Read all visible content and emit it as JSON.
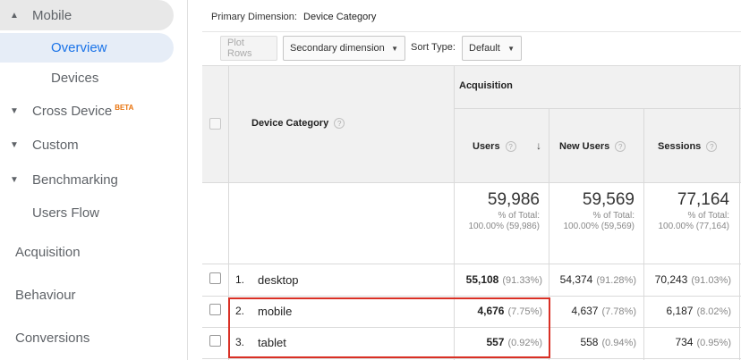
{
  "sidebar": {
    "mobile": "Mobile",
    "overview": "Overview",
    "devices": "Devices",
    "cross_device": "Cross Device",
    "cross_device_badge": "BETA",
    "custom": "Custom",
    "benchmarking": "Benchmarking",
    "users_flow": "Users Flow",
    "acquisition": "Acquisition",
    "behaviour": "Behaviour",
    "conversions": "Conversions"
  },
  "header": {
    "primary_dimension_label": "Primary Dimension:",
    "primary_dimension_value": "Device Category"
  },
  "toolbar": {
    "plot_rows": "Plot Rows",
    "secondary_dimension": "Secondary dimension",
    "sort_type_label": "Sort Type:",
    "sort_type_value": "Default"
  },
  "table": {
    "dimension_header": "Device Category",
    "group_header": "Acquisition",
    "columns": [
      "Users",
      "New Users",
      "Sessions"
    ],
    "totals": [
      {
        "value": "59,986",
        "label": "% of Total:",
        "detail": "100.00% (59,986)"
      },
      {
        "value": "59,569",
        "label": "% of Total:",
        "detail": "100.00% (59,569)"
      },
      {
        "value": "77,164",
        "label": "% of Total:",
        "detail": "100.00% (77,164)"
      }
    ],
    "rows": [
      {
        "rank": "1.",
        "name": "desktop",
        "users": "55,108",
        "users_pct": "(91.33%)",
        "new_users": "54,374",
        "new_users_pct": "(91.28%)",
        "sessions": "70,243",
        "sessions_pct": "(91.03%)"
      },
      {
        "rank": "2.",
        "name": "mobile",
        "users": "4,676",
        "users_pct": "(7.75%)",
        "new_users": "4,637",
        "new_users_pct": "(7.78%)",
        "sessions": "6,187",
        "sessions_pct": "(8.02%)"
      },
      {
        "rank": "3.",
        "name": "tablet",
        "users": "557",
        "users_pct": "(0.92%)",
        "new_users": "558",
        "new_users_pct": "(0.94%)",
        "sessions": "734",
        "sessions_pct": "(0.95%)"
      }
    ]
  },
  "colors": {
    "accent": "#1a73e8",
    "highlight_border": "#d93025",
    "beta_badge": "#e8710a"
  },
  "icons": {
    "expand": "caret-up-icon",
    "collapse": "caret-down-icon",
    "help": "question-circle-icon",
    "sort": "arrow-down-icon",
    "dropdown": "chevron-down-icon"
  }
}
